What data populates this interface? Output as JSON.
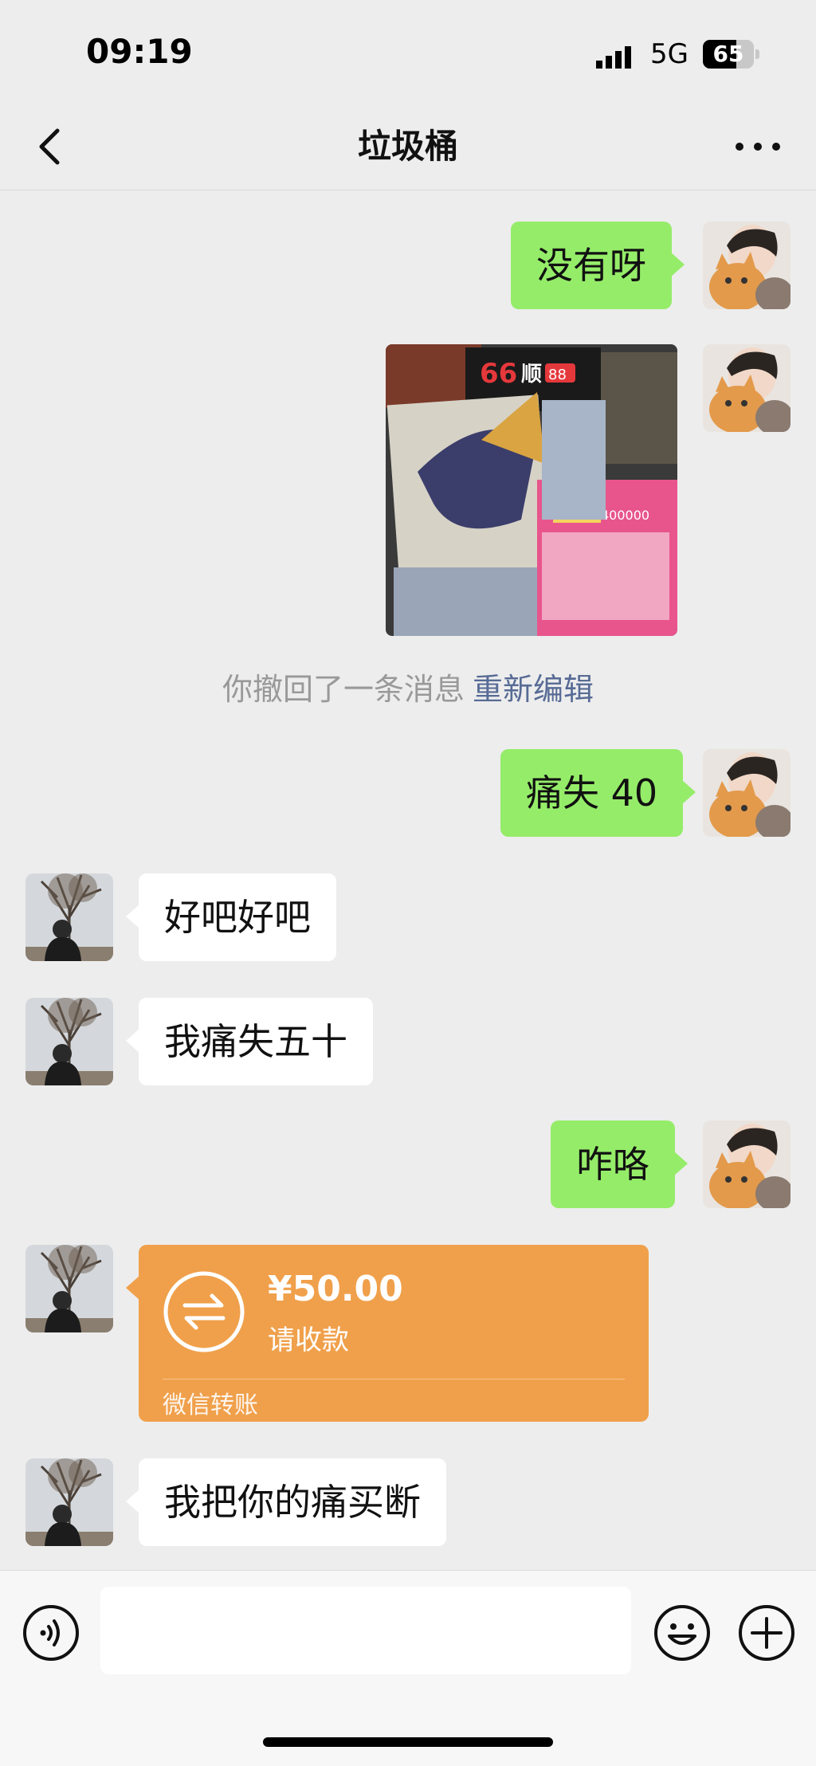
{
  "status_bar": {
    "time": "09:19",
    "network": "5G",
    "battery_level": "65"
  },
  "header": {
    "title": "垃圾桶"
  },
  "messages": [
    {
      "side": "right",
      "text": "没有呀"
    },
    {
      "side": "right",
      "type": "image",
      "icon": "photo-lottery-tickets"
    },
    {
      "type": "system"
    },
    {
      "side": "right",
      "text": "痛失 40"
    },
    {
      "side": "left",
      "text": "好吧好吧"
    },
    {
      "side": "left",
      "text": "我痛失五十"
    },
    {
      "side": "right",
      "text": "咋咯"
    },
    {
      "side": "left",
      "type": "transfer"
    },
    {
      "side": "left",
      "text": "我把你的痛买断"
    }
  ],
  "system_note": {
    "text": "你撤回了一条消息",
    "action": "重新编辑"
  },
  "transfer": {
    "amount": "¥50.00",
    "status": "请收款",
    "brand": "微信转账"
  },
  "colors": {
    "background": "#ededed",
    "bubble_self": "#95ec69",
    "bubble_other": "#ffffff",
    "transfer_card": "#f0a04b",
    "link": "#576b95"
  }
}
